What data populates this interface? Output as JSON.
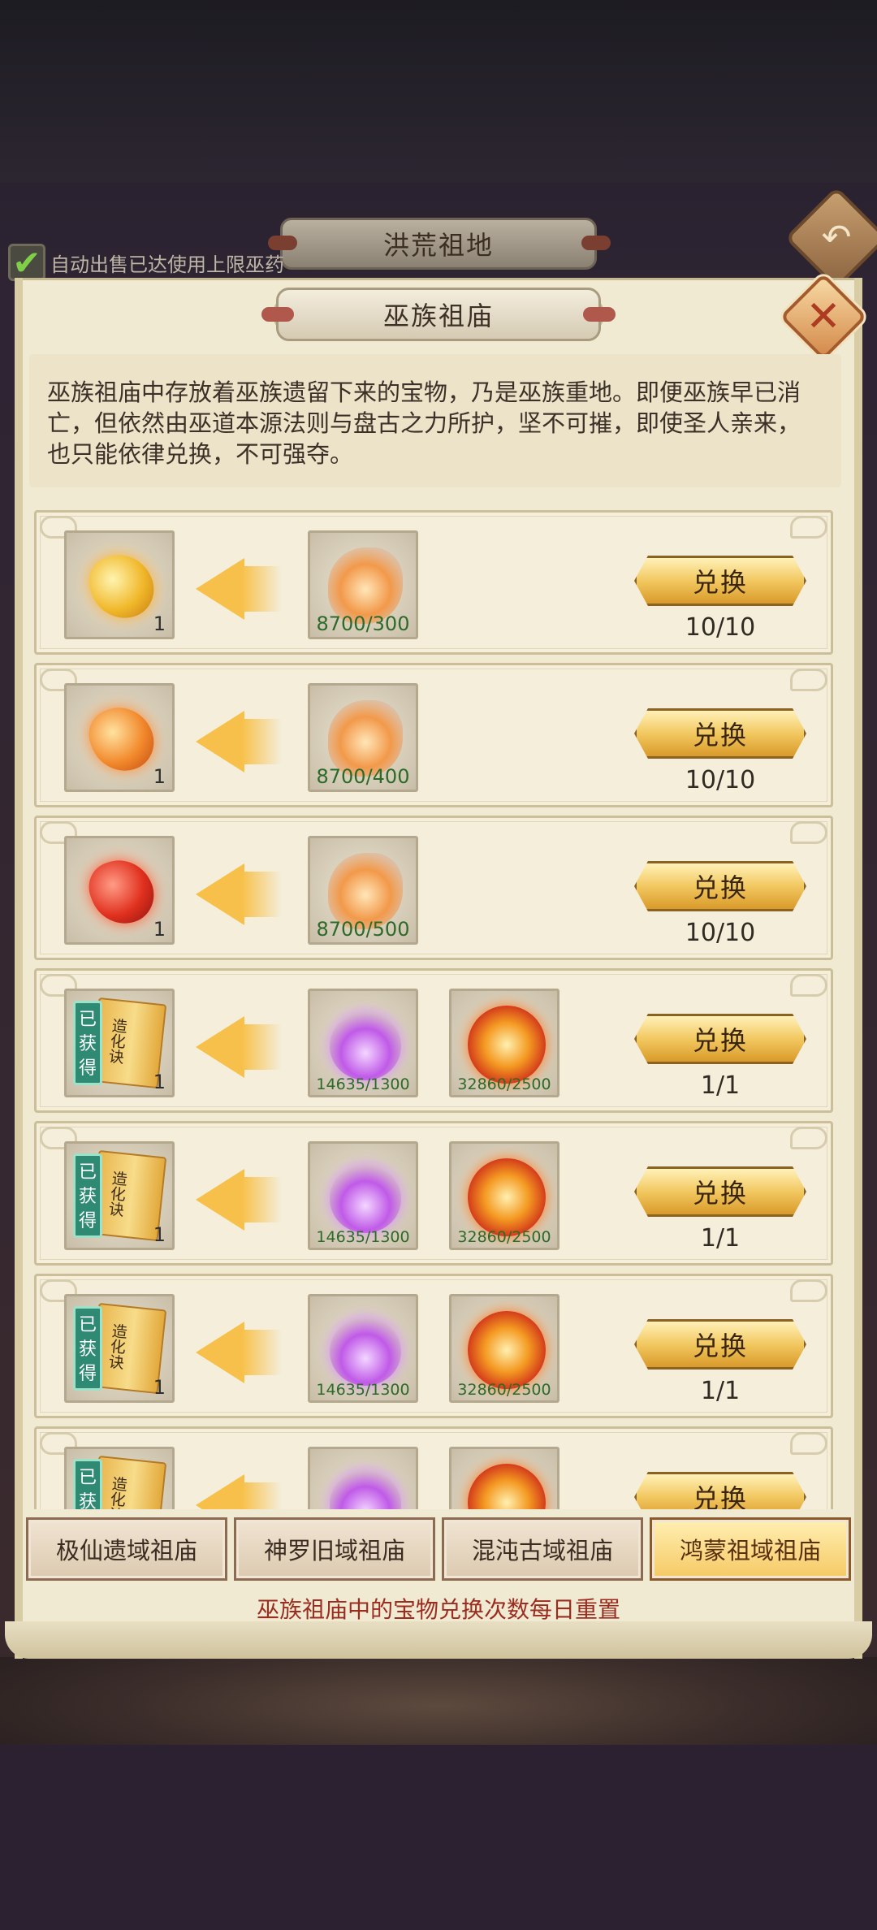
{
  "outer": {
    "title": "洪荒祖地",
    "auto_sell_label": "自动出售已达使用上限巫药",
    "auto_sell_checked": true
  },
  "dialog": {
    "title": "巫族祖庙",
    "description": "巫族祖庙中存放着巫族遗留下来的宝物，乃是巫族重地。即便巫族早已消亡，但依然由巫道本源法则与盘古之力所护，坚不可摧，即使圣人亲来，也只能依律兑换，不可强夺。"
  },
  "rows": [
    {
      "reward_icon": "gold-gem-icon",
      "reward_count": "1",
      "costs": [
        {
          "icon": "flame-scroll-icon",
          "need": "8700/300"
        }
      ],
      "button": "兑换",
      "limit": "10/10"
    },
    {
      "reward_icon": "orange-gem-icon",
      "reward_count": "1",
      "costs": [
        {
          "icon": "flame-scroll-icon",
          "need": "8700/400"
        }
      ],
      "button": "兑换",
      "limit": "10/10"
    },
    {
      "reward_icon": "red-gem-icon",
      "reward_count": "1",
      "costs": [
        {
          "icon": "flame-scroll-icon",
          "need": "8700/500"
        }
      ],
      "button": "兑换",
      "limit": "10/10"
    },
    {
      "reward_icon": "skill-book-icon",
      "reward_book": "造化诀",
      "reward_tag": "已获得",
      "reward_count": "1",
      "costs": [
        {
          "icon": "violet-orb-icon",
          "need": "14635/1300"
        },
        {
          "icon": "fire-orb-icon",
          "need": "32860/2500"
        }
      ],
      "button": "兑换",
      "limit": "1/1"
    },
    {
      "reward_icon": "skill-book-icon",
      "reward_book": "造化诀",
      "reward_tag": "已获得",
      "reward_count": "1",
      "costs": [
        {
          "icon": "violet-orb-icon",
          "need": "14635/1300"
        },
        {
          "icon": "fire-orb-icon",
          "need": "32860/2500"
        }
      ],
      "button": "兑换",
      "limit": "1/1"
    },
    {
      "reward_icon": "skill-book-icon",
      "reward_book": "造化诀",
      "reward_tag": "已获得",
      "reward_count": "1",
      "costs": [
        {
          "icon": "violet-orb-icon",
          "need": "14635/1300"
        },
        {
          "icon": "fire-orb-icon",
          "need": "32860/2500"
        }
      ],
      "button": "兑换",
      "limit": "1/1"
    },
    {
      "reward_icon": "skill-book-icon",
      "reward_book": "造化诀",
      "reward_tag": "已获得",
      "reward_count": "",
      "costs": [
        {
          "icon": "violet-orb-icon",
          "need": ""
        },
        {
          "icon": "fire-orb-icon",
          "need": ""
        }
      ],
      "button": "兑换",
      "limit": ""
    }
  ],
  "tabs": [
    {
      "label": "极仙遗域祖庙",
      "active": false
    },
    {
      "label": "神罗旧域祖庙",
      "active": false
    },
    {
      "label": "混沌古域祖庙",
      "active": false
    },
    {
      "label": "鸿蒙祖域祖庙",
      "active": true
    }
  ],
  "reset_note": "巫族祖庙中的宝物兑换次数每日重置",
  "colors": {
    "panel": "#f1ead3",
    "button_gold": "#f2c860",
    "need_text": "#2d6a2a",
    "note_text": "#9b2d20",
    "got_tag": "#2f8a74"
  }
}
